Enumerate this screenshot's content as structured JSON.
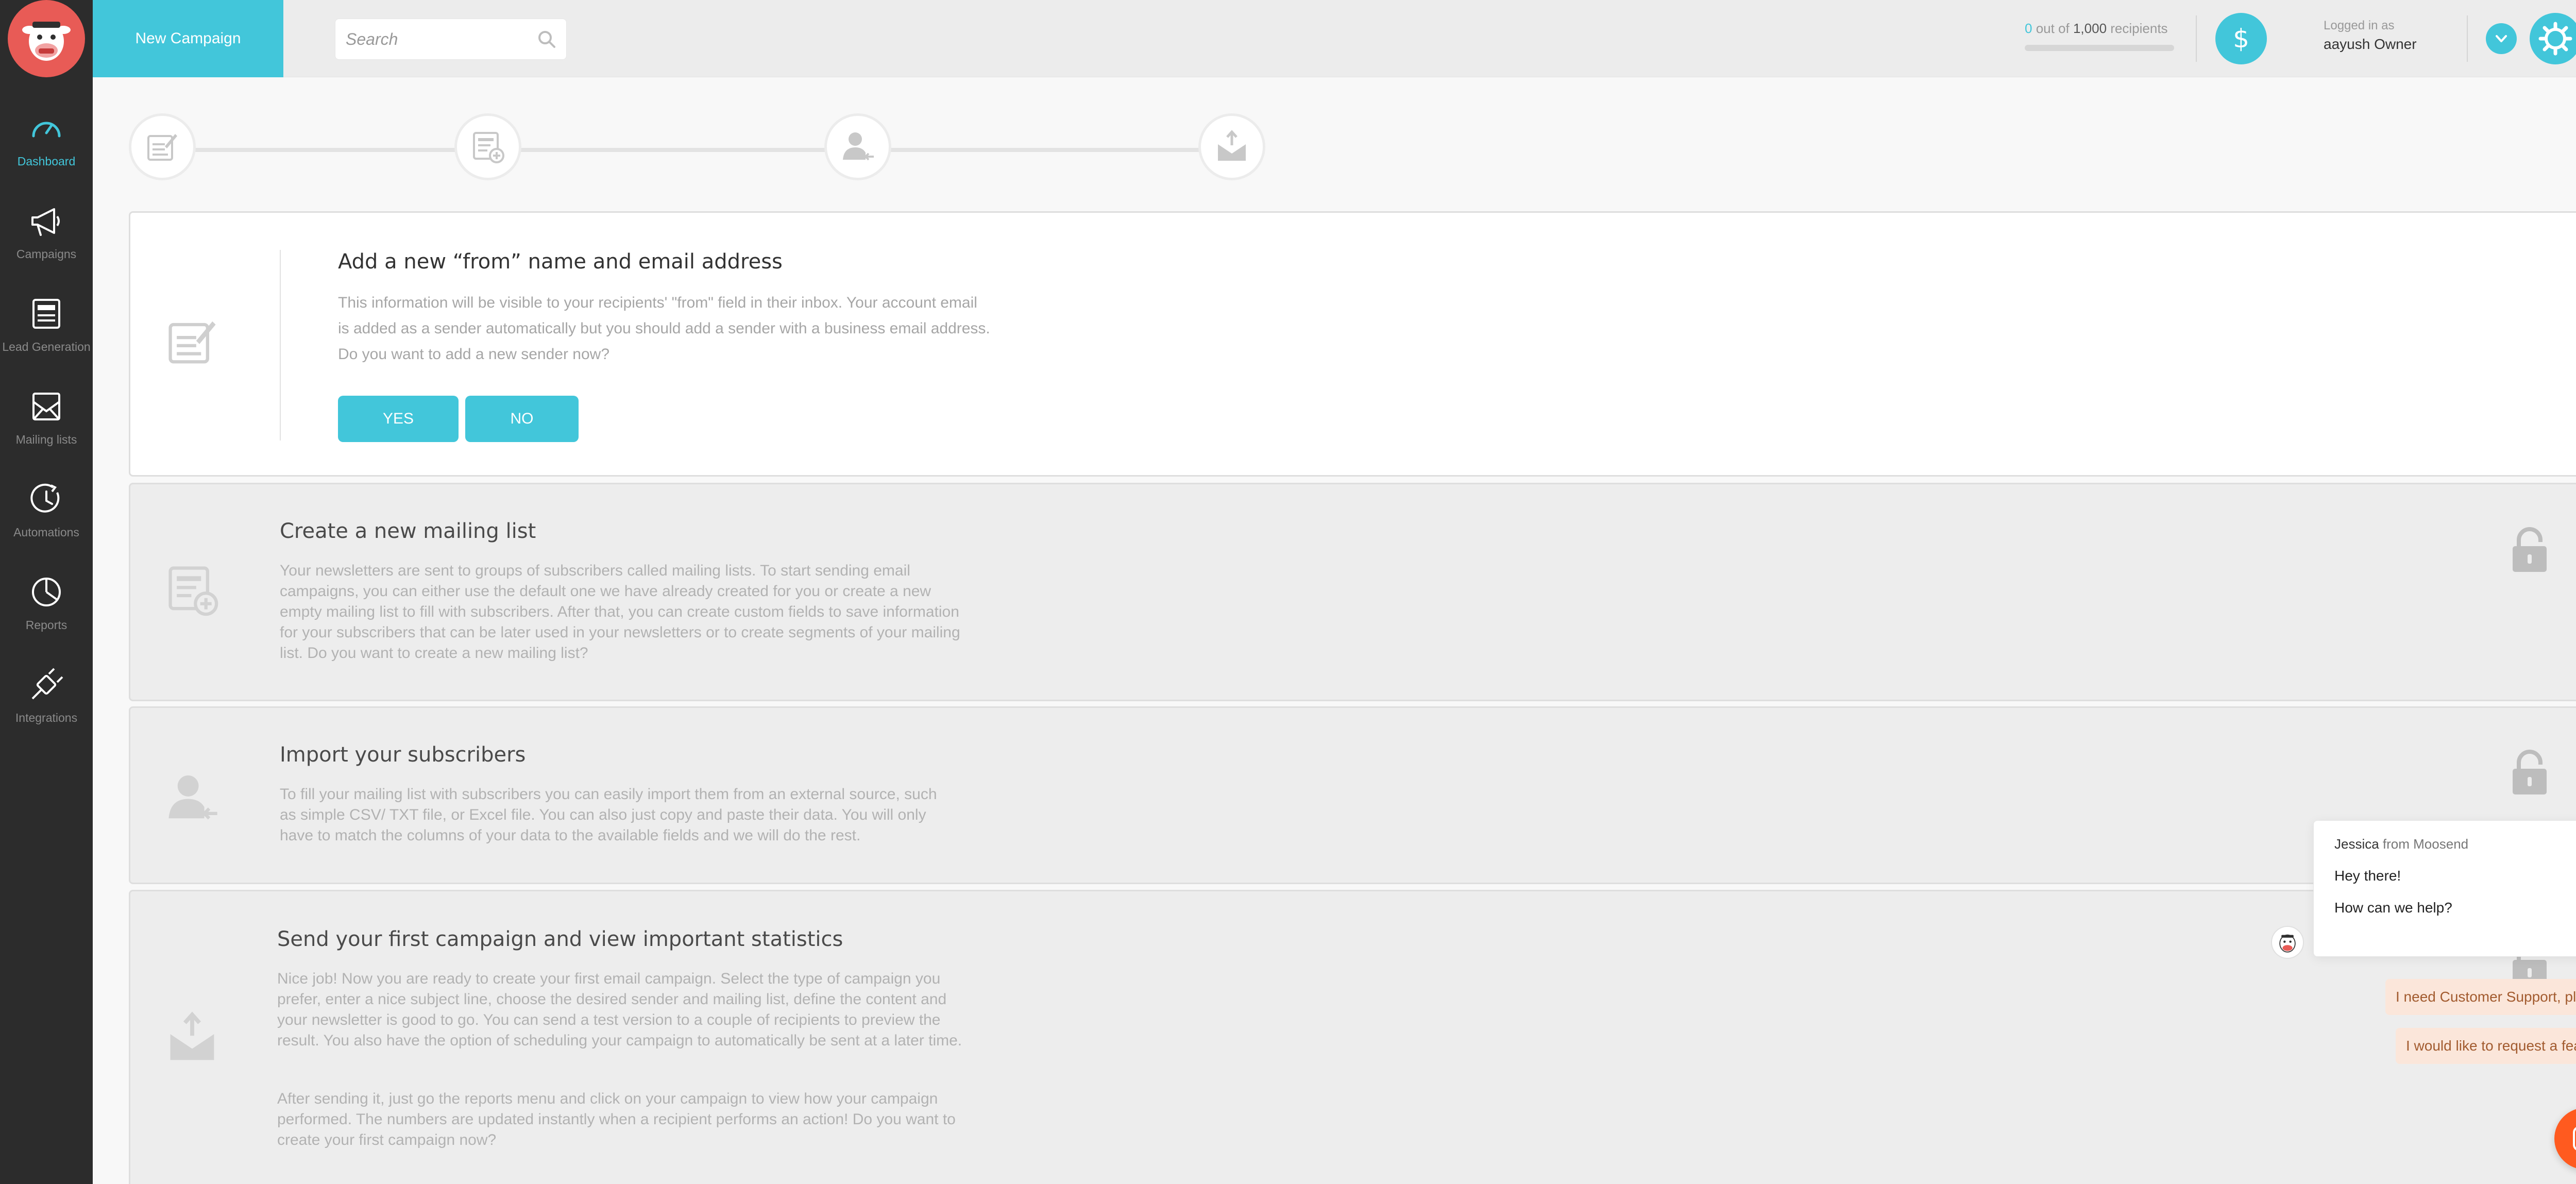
{
  "colors": {
    "accent": "#42c6da",
    "sidebar_bg": "#2c2c2c",
    "logo_bg": "#e85b56",
    "chat_launcher": "#ff5a1f",
    "quick_reply_bg": "#fbe6da"
  },
  "sidebar": {
    "items": [
      {
        "label": "Dashboard",
        "icon": "speedometer-icon",
        "active": true
      },
      {
        "label": "Campaigns",
        "icon": "megaphone-icon",
        "active": false
      },
      {
        "label": "Lead Generation",
        "icon": "form-icon",
        "active": false
      },
      {
        "label": "Mailing lists",
        "icon": "envelope-icon",
        "active": false
      },
      {
        "label": "Automations",
        "icon": "clock-icon",
        "active": false
      },
      {
        "label": "Reports",
        "icon": "pie-chart-icon",
        "active": false
      },
      {
        "label": "Integrations",
        "icon": "plug-icon",
        "active": false
      }
    ]
  },
  "header": {
    "new_campaign_label": "New Campaign",
    "search_placeholder": "Search",
    "recipients": {
      "count": "0",
      "out_of": " out of ",
      "total": "1,000",
      "unit": " recipients",
      "progress": 0
    },
    "logged_in_label": "Logged in as",
    "user_name": "aayush Owner"
  },
  "steps": [
    {
      "icon": "sender-edit-icon"
    },
    {
      "icon": "list-add-icon"
    },
    {
      "icon": "user-import-icon"
    },
    {
      "icon": "send-envelope-icon"
    }
  ],
  "cards": {
    "sender": {
      "title": "Add a new “from” name and email address",
      "description": "This information will be visible to your recipients' \"from\" field in their inbox. Your account email is added as a sender automatically but you should add a sender with a business email address. Do you want to add a new sender now?",
      "yes_label": "YES",
      "no_label": "NO"
    },
    "mailing_list": {
      "title": "Create a new mailing list",
      "description": "Your newsletters are sent to groups of subscribers called mailing lists. To start sending email campaigns, you can either use the default one we have already created for you or create a new empty mailing list to fill with subscribers. After that, you can create custom fields to save information for your subscribers that can be later used in your newsletters or to create segments of your mailing list. Do you want to create a new mailing list?"
    },
    "import": {
      "title": "Import your subscribers",
      "description": "To fill your mailing list with subscribers you can easily import them from an external source, such as simple CSV/ TXT file, or Excel file. You can also just copy and paste their data. You will only have to match the columns of your data to the available fields and we will do the rest."
    },
    "campaign": {
      "title": "Send your first campaign and view important statistics",
      "description_1": "Nice job! Now you are ready to create your first email campaign. Select the type of campaign you prefer, enter a nice subject line, choose the desired sender and mailing list, define the content and your newsletter is good to go. You can send a test version to a couple of recipients to preview the result. You also have the option of scheduling your campaign to automatically be sent at a later time.",
      "description_2": "After sending it, just go the reports menu and click on your campaign to view how your campaign performed. The numbers are updated instantly when a recipient performs an action! Do you want to create your first campaign now?"
    }
  },
  "chat": {
    "agent_name": "Jessica",
    "from_text": " from Moosend",
    "greeting": "Hey there!",
    "question": "How can we help?",
    "quick_replies": [
      "I need Customer Support, please.",
      "I would like to request a feature!"
    ]
  }
}
